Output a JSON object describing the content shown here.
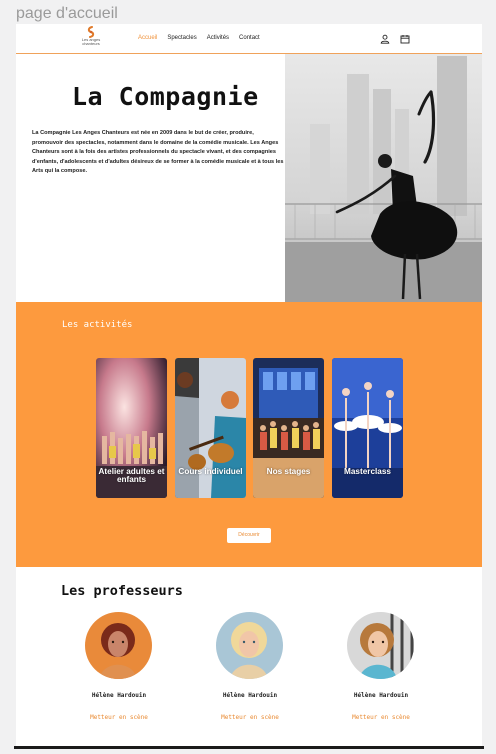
{
  "frame_label": "page d'accueil",
  "header": {
    "logo_line1": "Les anges",
    "logo_line2": "chanteurs",
    "nav": [
      "Accueil",
      "Spectacles",
      "Activités",
      "Contact"
    ],
    "active_nav": "Accueil",
    "icons": [
      "user-icon",
      "calendar-icon"
    ]
  },
  "hero": {
    "title": "La Compagnie",
    "text": "La Compagnie Les Anges Chanteurs est née en 2009 dans le but de créer, produire, promouvoir des spectacles, notamment dans le domaine de la comédie musicale. Les Anges Chanteurs sont à la fois des artistes professionnels du spectacle vivant, et des compagnies d'enfants, d'adolescents et d'adultes désireux de se former à la comédie musicale et à tous les Arts qui la compose."
  },
  "activities": {
    "title": "Les activités",
    "cards": [
      {
        "label": "Atelier adultes et enfants"
      },
      {
        "label": "Cours individuel"
      },
      {
        "label": "Nos stages"
      },
      {
        "label": "Masterclass"
      }
    ],
    "button": "Découvrir"
  },
  "teachers": {
    "title": "Les professeurs",
    "items": [
      {
        "name": "Hélène Hardouin",
        "role": "Metteur en scène"
      },
      {
        "name": "Hélène Hardouin",
        "role": "Metteur en scène"
      },
      {
        "name": "Hélène Hardouin",
        "role": "Metteur en scène"
      }
    ]
  },
  "colors": {
    "accent": "#fd9a3e",
    "accent_text": "#e98a32",
    "background": "#f1f1f2"
  }
}
